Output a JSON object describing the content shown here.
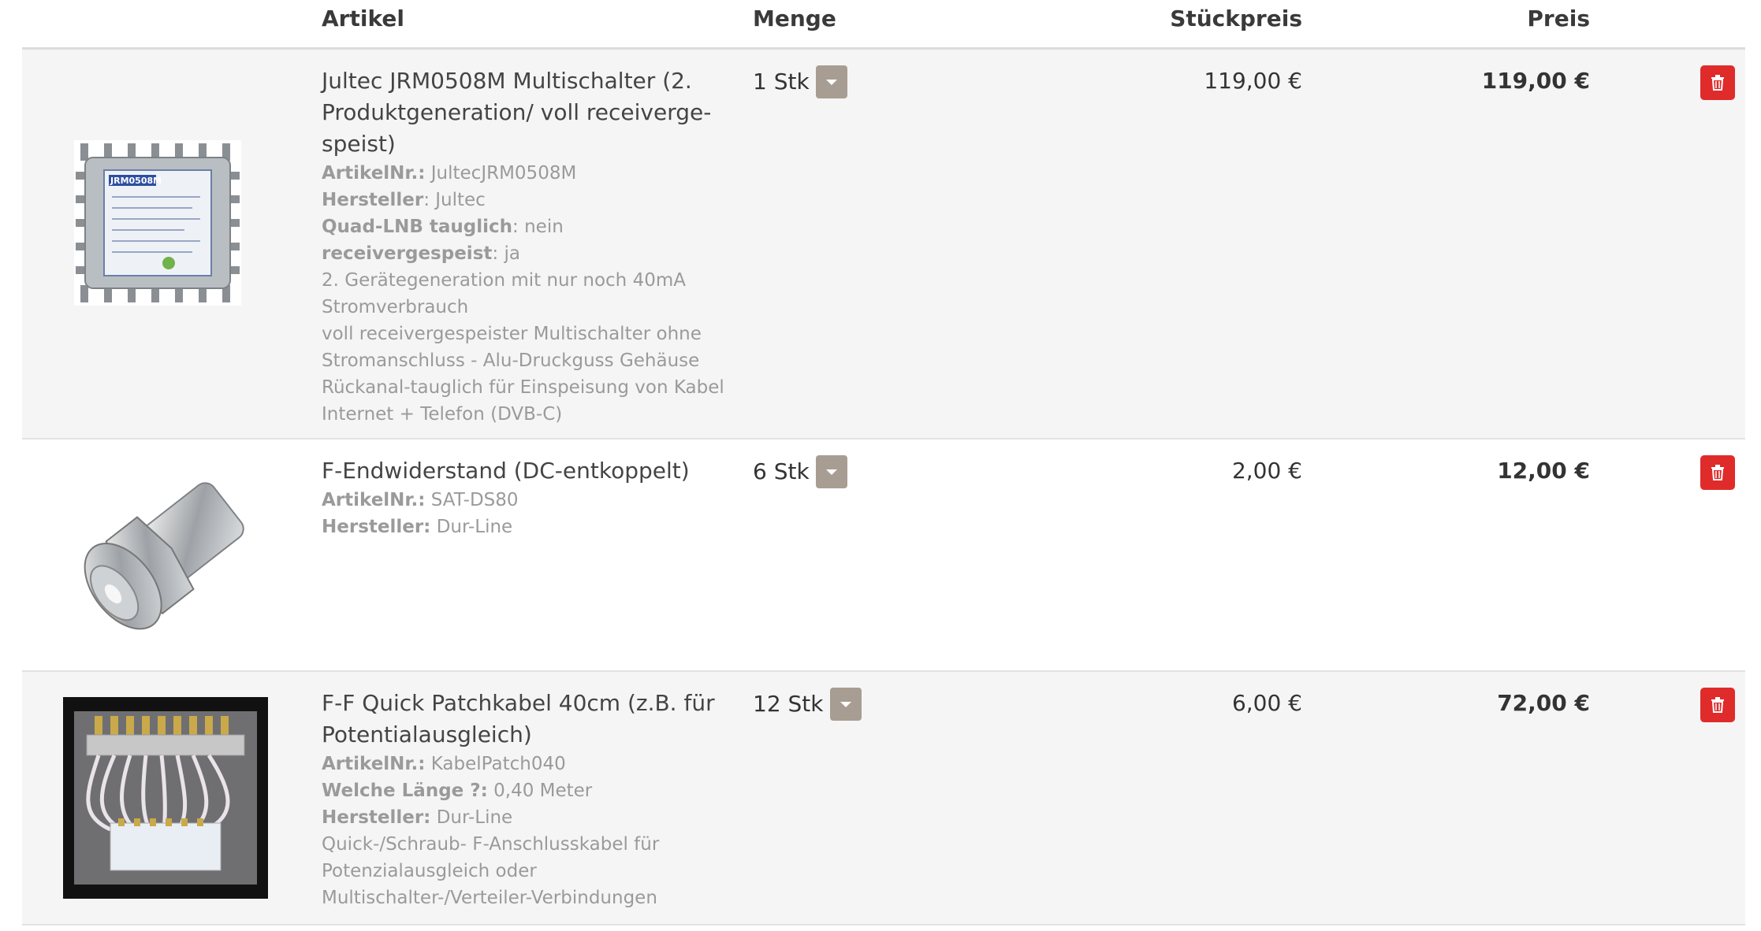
{
  "header": {
    "artikel": "Artikel",
    "menge": "Menge",
    "stueckpreis": "Stückpreis",
    "preis": "Preis"
  },
  "items": [
    {
      "name_line1": "Jultec JRM0508M Multischalter (2.",
      "name_line2": "Produktgeneration/ voll receiverge-",
      "name_line3": "speist)",
      "attrs": [
        {
          "label": "ArtikelNr.:",
          "value": " JultecJRM0508M"
        },
        {
          "label": "Hersteller",
          "value": ": Jultec"
        },
        {
          "label": "Quad-LNB tauglich",
          "value": ": nein"
        },
        {
          "label": "receivergespeist",
          "value": ": ja"
        }
      ],
      "desc": [
        "2. Gerätegeneration mit nur noch 40mA",
        "Stromverbrauch",
        "voll receivergespeister Multischalter ohne",
        "Stromanschluss - Alu-Druckguss Gehäuse",
        "Rückanal-tauglich für Einspeisung von Kabel",
        "Internet + Telefon (DVB-C)"
      ],
      "qty": "1 Stk",
      "unit_price": "119,00 €",
      "total": "119,00 €",
      "image_icon": "multiswitch-image"
    },
    {
      "name_line1": "F-Endwiderstand (DC-entkoppelt)",
      "attrs": [
        {
          "label": "ArtikelNr.:",
          "value": " SAT-DS80"
        },
        {
          "label": "Hersteller:",
          "value": " Dur-Line"
        }
      ],
      "qty": "6 Stk",
      "unit_price": "2,00 €",
      "total": "12,00 €",
      "image_icon": "f-connector-image"
    },
    {
      "name_line1": "F-F Quick Patchkabel 40cm (z.B. für",
      "name_line2": "Potentialausgleich)",
      "attrs": [
        {
          "label": "ArtikelNr.:",
          "value": " KabelPatch040"
        },
        {
          "label": "Welche Länge ?:",
          "value": " 0,40 Meter"
        },
        {
          "label": "Hersteller:",
          "value": " Dur-Line"
        }
      ],
      "desc": [
        "Quick-/Schraub- F-Anschlusskabel für",
        "Potenzialausgleich oder",
        "Multischalter-/Verteiler-Verbindungen"
      ],
      "qty": "12 Stk",
      "unit_price": "6,00 €",
      "total": "72,00 €",
      "image_icon": "patch-cable-image"
    }
  ],
  "icons": {
    "delete": "trash-icon",
    "dropdown": "chevron-down-icon"
  },
  "colors": {
    "delete_button": "#e02b2b",
    "dropdown_button": "#a89d92",
    "row_shade": "#f5f5f5"
  },
  "images": {
    "multiswitch_label": "JRM0508M"
  }
}
